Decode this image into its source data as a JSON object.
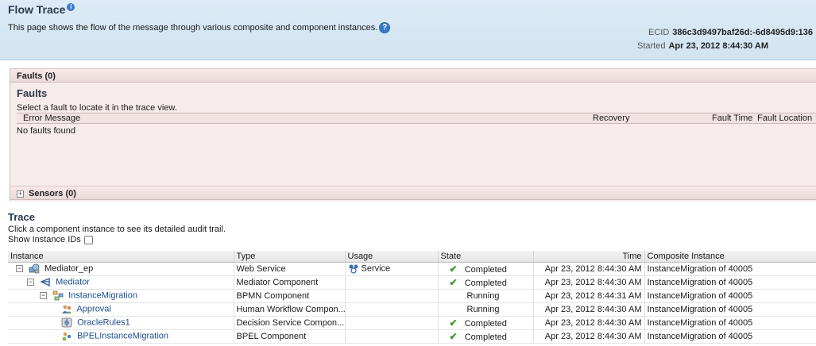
{
  "header": {
    "title": "Flow Trace",
    "subtitle": "This page shows the flow of the message through various composite and component instances.",
    "ecid_label": "ECID",
    "ecid_value": "386c3d9497baf26d:-6d8495d9:136",
    "started_label": "Started",
    "started_value": "Apr 23, 2012 8:44:30 AM"
  },
  "faults": {
    "bar_label": "Faults (0)",
    "heading": "Faults",
    "hint": "Select a fault to locate it in the trace view.",
    "columns": [
      "Error Message",
      "Recovery",
      "Fault Time",
      "Fault Location"
    ],
    "empty_text": "No faults found"
  },
  "sensors": {
    "bar_label": "Sensors (0)"
  },
  "trace": {
    "heading": "Trace",
    "hint": "Click a component instance to see its detailed audit trail.",
    "show_ids_label": "Show Instance IDs",
    "columns": [
      "Instance",
      "Type",
      "Usage",
      "State",
      "Time",
      "Composite Instance"
    ],
    "rows": [
      {
        "instance": "Mediator_ep",
        "type": "Web Service",
        "usage": "Service",
        "state": "Completed",
        "time": "Apr 23, 2012 8:44:30 AM",
        "composite": "InstanceMigration of 40005"
      },
      {
        "instance": "Mediator",
        "type": "Mediator Component",
        "usage": "",
        "state": "Completed",
        "time": "Apr 23, 2012 8:44:30 AM",
        "composite": "InstanceMigration of 40005"
      },
      {
        "instance": "InstanceMigration",
        "type": "BPMN Component",
        "usage": "",
        "state": "Running",
        "time": "Apr 23, 2012 8:44:31 AM",
        "composite": "InstanceMigration of 40005"
      },
      {
        "instance": "Approval",
        "type": "Human Workflow Compon...",
        "usage": "",
        "state": "Running",
        "time": "Apr 23, 2012 8:44:30 AM",
        "composite": "InstanceMigration of 40005"
      },
      {
        "instance": "OracleRules1",
        "type": "Decision Service Compon...",
        "usage": "",
        "state": "Completed",
        "time": "Apr 23, 2012 8:44:30 AM",
        "composite": "InstanceMigration of 40005"
      },
      {
        "instance": "BPELInstanceMigration",
        "type": "BPEL Component",
        "usage": "",
        "state": "Completed",
        "time": "Apr 23, 2012 8:44:30 AM",
        "composite": "InstanceMigration of 40005"
      }
    ]
  },
  "icons": [
    "info-icon",
    "help-icon",
    "expand-icon",
    "collapse-icon",
    "web-service-icon",
    "mediator-icon",
    "bpmn-icon",
    "human-workflow-icon",
    "decision-service-icon",
    "bpel-icon",
    "service-usage-icon",
    "checkmark-icon"
  ],
  "colors": {
    "header_bg": "#d6e8f5",
    "faults_bg": "#f7ebeb",
    "link": "#1e4f8e",
    "success": "#3a9a2a"
  }
}
